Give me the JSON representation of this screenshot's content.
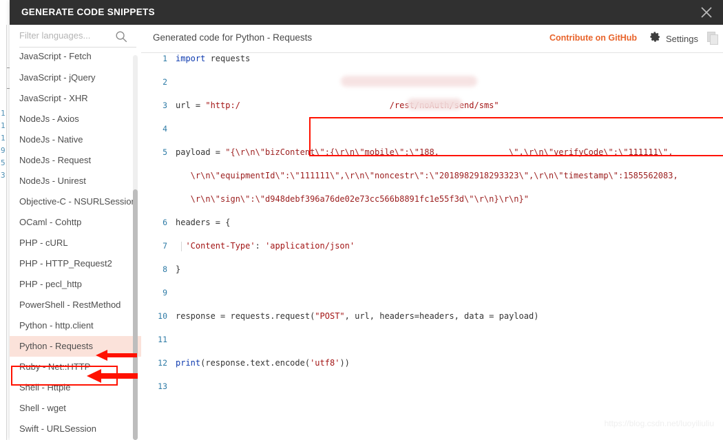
{
  "window": {
    "title": "GENERATE CODE SNIPPETS",
    "close_icon": "close-icon"
  },
  "sidebar": {
    "search": {
      "placeholder": "Filter languages...",
      "value": "",
      "icon": "search-icon"
    },
    "items": [
      {
        "label": "JavaScript - Fetch",
        "selected": false,
        "clipped": true
      },
      {
        "label": "JavaScript - jQuery",
        "selected": false
      },
      {
        "label": "JavaScript - XHR",
        "selected": false
      },
      {
        "label": "NodeJs - Axios",
        "selected": false
      },
      {
        "label": "NodeJs - Native",
        "selected": false
      },
      {
        "label": "NodeJs - Request",
        "selected": false
      },
      {
        "label": "NodeJs - Unirest",
        "selected": false
      },
      {
        "label": "Objective-C - NSURLSession",
        "selected": false
      },
      {
        "label": "OCaml - Cohttp",
        "selected": false
      },
      {
        "label": "PHP - cURL",
        "selected": false
      },
      {
        "label": "PHP - HTTP_Request2",
        "selected": false
      },
      {
        "label": "PHP - pecl_http",
        "selected": false
      },
      {
        "label": "PowerShell - RestMethod",
        "selected": false
      },
      {
        "label": "Python - http.client",
        "selected": false
      },
      {
        "label": "Python - Requests",
        "selected": true
      },
      {
        "label": "Ruby - Net::HTTP",
        "selected": false
      },
      {
        "label": "Shell - Httpie",
        "selected": false
      },
      {
        "label": "Shell - wget",
        "selected": false
      },
      {
        "label": "Swift - URLSession",
        "selected": false
      }
    ]
  },
  "panel": {
    "title": "Generated code for Python - Requests",
    "contribute_label": "Contribute on GitHub",
    "settings_label": "Settings",
    "settings_icon": "gear-icon",
    "copy_icon": "copy-icon"
  },
  "code": {
    "language": "python",
    "line_count": 13,
    "lines": [
      {
        "n": "1",
        "text": "import requests"
      },
      {
        "n": "2",
        "text": ""
      },
      {
        "n": "3",
        "text": "url = \"http:/                              /rest/noAuth/send/sms\""
      },
      {
        "n": "4",
        "text": ""
      },
      {
        "n": "5",
        "text": "payload = \"{\\r\\n\\\"bizContent\\\":{\\r\\n\\\"mobile\\\":\\\"188.           \\\",\\r\\n\\\"verifyCode\\\":\\\"111111\\\","
      },
      {
        "n": "",
        "text": "   \\r\\n\\\"equipmentId\\\":\\\"111111\\\",\\r\\n\\\"noncestr\\\":\\\"2018982918293323\\\",\\r\\n\\\"timestamp\\\":1585562083,"
      },
      {
        "n": "",
        "text": "   \\r\\n\\\"sign\\\":\\\"d948debf396a76de02e73cc566b8891fc1e55f3d\\\"\\r\\n}\\r\\n}\""
      },
      {
        "n": "6",
        "text": "headers = {"
      },
      {
        "n": "7",
        "text": "  'Content-Type': 'application/json'"
      },
      {
        "n": "8",
        "text": "}"
      },
      {
        "n": "9",
        "text": ""
      },
      {
        "n": "10",
        "text": "response = requests.request(\"POST\", url, headers=headers, data = payload)"
      },
      {
        "n": "11",
        "text": ""
      },
      {
        "n": "12",
        "text": "print(response.text.encode('utf8'))"
      },
      {
        "n": "13",
        "text": ""
      }
    ]
  },
  "annotations": {
    "highlight_color": "#ff1100",
    "selected_row_color": "#fbe2da",
    "payload_box_label": "payload-highlight-box",
    "arrows": [
      "arrow-python-http-client",
      "arrow-python-requests"
    ]
  },
  "watermark": {
    "text": "https://blog.csdn.net/luoyiliuliu"
  },
  "colors": {
    "titlebar": "#303030",
    "accent_orange": "#e8642b",
    "linenum_blue": "#2e7ba6",
    "keyword_blue": "#0d3aaf",
    "string_red": "#a31515"
  }
}
